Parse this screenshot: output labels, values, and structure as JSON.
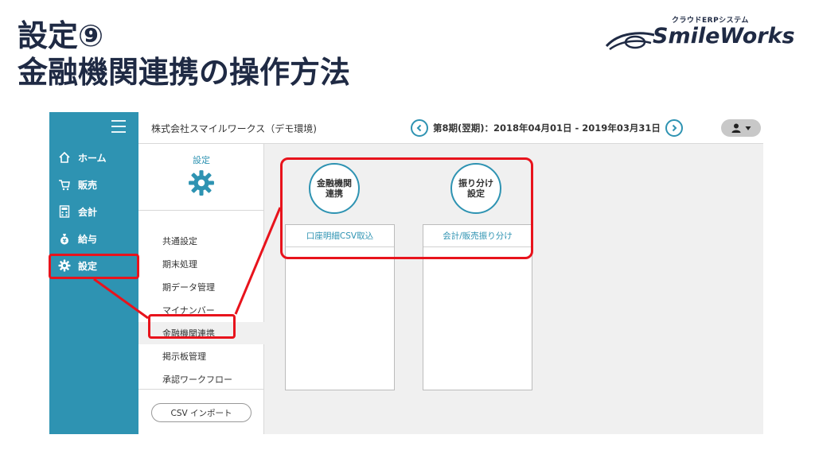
{
  "slide": {
    "title_line1": "設定⑨",
    "title_line2": "金融機関連携の操作方法"
  },
  "brand": {
    "tagline": "クラウドERPシステム",
    "name": "SmileWorks"
  },
  "sidebar": {
    "items": [
      {
        "label": "ホーム",
        "icon": "home-icon"
      },
      {
        "label": "販売",
        "icon": "cart-icon"
      },
      {
        "label": "会計",
        "icon": "calculator-icon"
      },
      {
        "label": "給与",
        "icon": "money-bag-icon"
      },
      {
        "label": "設定",
        "icon": "gear-icon"
      }
    ]
  },
  "topbar": {
    "company": "株式会社スマイルワークス（デモ環境)",
    "period": "第8期(翌期)：2018年04月01日 - 2019年03月31日"
  },
  "subpanel": {
    "title": "設定",
    "items": [
      {
        "label": "共通設定"
      },
      {
        "label": "期末処理"
      },
      {
        "label": "期データ管理"
      },
      {
        "label": "マイナンバー"
      },
      {
        "label": "金融機関連携"
      },
      {
        "label": "掲示板管理"
      },
      {
        "label": "承認ワークフロー"
      }
    ],
    "csv_button": "CSV インポート"
  },
  "content": {
    "columns": [
      {
        "badge": "金融機関\n連携",
        "link": "口座明細CSV取込"
      },
      {
        "badge": "振り分け\n設定",
        "link": "会計/販売振り分け"
      }
    ]
  },
  "colors": {
    "accent": "#2e93b2",
    "highlight": "#e8131c",
    "title": "#1f2a44"
  }
}
